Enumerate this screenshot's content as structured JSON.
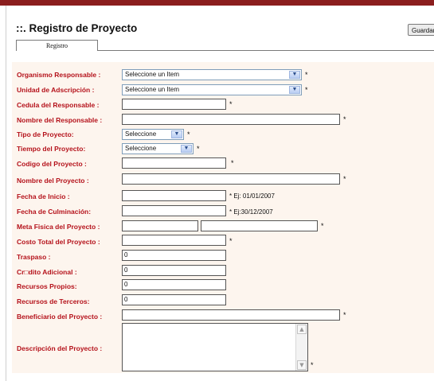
{
  "header": {
    "title": "::. Registro de Proyecto",
    "save_button": "Guardar",
    "tab": "Registro"
  },
  "fields": {
    "organismo": {
      "label": "Organismo Responsable :",
      "value": "Seleccione un Item",
      "required": "*"
    },
    "unidad": {
      "label": "Unidad de Adscripción :",
      "value": "Seleccione un Item",
      "required": "*"
    },
    "cedula": {
      "label": "Cedula del Responsable :",
      "value": "",
      "required": "*"
    },
    "nombre_responsable": {
      "label": "Nombre del Responsable :",
      "value": "",
      "required": "*"
    },
    "tipo": {
      "label": "Tipo de Proyecto:",
      "value": "Seleccione",
      "required": "*"
    },
    "tiempo": {
      "label": "Tiempo del Proyecto:",
      "value": "Seleccione",
      "required": "*"
    },
    "codigo": {
      "label": "Codigo del Proyecto :",
      "value": "",
      "required": "*"
    },
    "nombre_proyecto": {
      "label": "Nombre del Proyecto :",
      "value": "",
      "required": "*"
    },
    "fecha_inicio": {
      "label": "Fecha de Inicio :",
      "value": "",
      "hint": "* Ej: 01/01/2007"
    },
    "fecha_culminacion": {
      "label": "Fecha de Culminación:",
      "value": "",
      "hint": "* Ej:30/12/2007"
    },
    "meta_fisica": {
      "label": "Meta Fisica del Proyecto :",
      "value1": "",
      "value2": "",
      "required": "*"
    },
    "costo_total": {
      "label": "Costo Total del Proyecto :",
      "value": "",
      "required": "*"
    },
    "traspaso": {
      "label": "Traspaso :",
      "value": "0"
    },
    "credito": {
      "label": "Cr□dito Adicional :",
      "value": "0"
    },
    "recursos_propios": {
      "label": "Recursos Propios:",
      "value": "0"
    },
    "recursos_terceros": {
      "label": "Recursos de Terceros:",
      "value": "0"
    },
    "beneficiario": {
      "label": "Beneficiario del Proyecto :",
      "value": "",
      "required": "*"
    },
    "descripcion": {
      "label": "Descripción del Proyecto :",
      "value": "",
      "required": "*"
    }
  },
  "icons": {
    "dropdown_arrow": "chevron-down-icon",
    "scroll_up": "scroll-up-arrow-icon",
    "scroll_down": "scroll-down-arrow-icon"
  },
  "colors": {
    "label_text": "#b5121b",
    "panel_background": "#fdf5ee",
    "top_bar": "#8b1e1e"
  }
}
